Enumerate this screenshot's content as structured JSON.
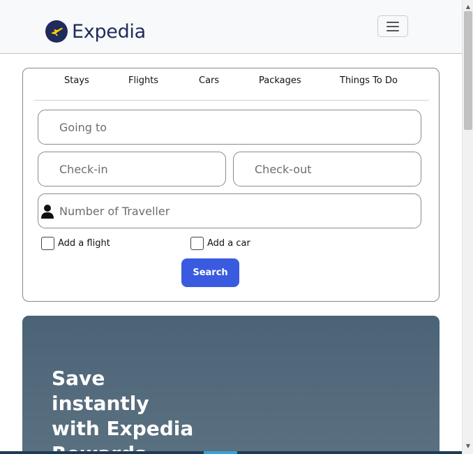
{
  "header": {
    "brand": "Expedia",
    "menu_icon": "hamburger-icon"
  },
  "tabs": [
    "Stays",
    "Flights",
    "Cars",
    "Packages",
    "Things To Do"
  ],
  "form": {
    "destination_placeholder": "Going to",
    "checkin_placeholder": "Check-in",
    "checkout_placeholder": "Check-out",
    "travellers_placeholder": "Number of Traveller",
    "travellers_icon": "person-icon",
    "add_flight_label": "Add a flight",
    "add_car_label": "Add a car",
    "add_flight_checked": false,
    "add_car_checked": false,
    "search_label": "Search"
  },
  "hero": {
    "title": "Save instantly with Expedia Rewards"
  },
  "colors": {
    "brand_navy": "#1f2b5b",
    "brand_yellow": "#fdd000",
    "search_button": "#3a5be0",
    "hero_background": "#4f677a"
  }
}
